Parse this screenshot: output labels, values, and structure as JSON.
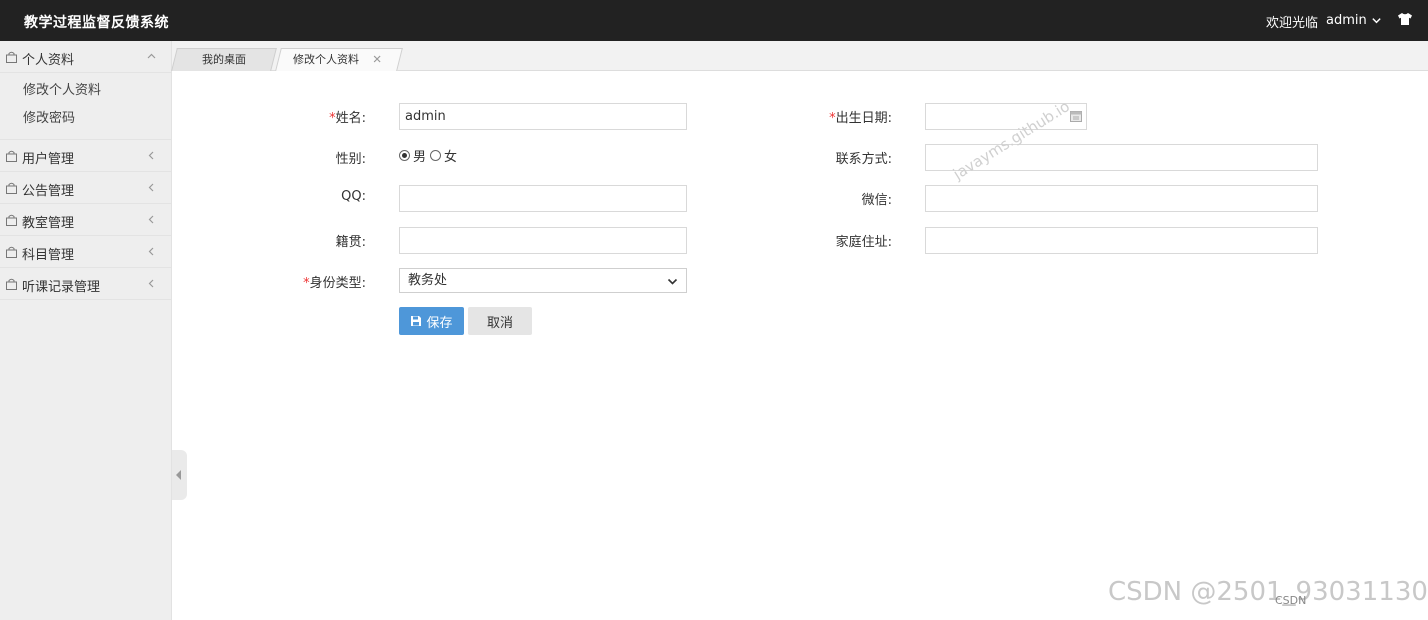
{
  "header": {
    "app_title": "教学过程监督反馈系统",
    "welcome": "欢迎光临",
    "username": "admin"
  },
  "sidebar": {
    "groups": [
      {
        "label": "个人资料",
        "expanded": true,
        "items": [
          "修改个人资料",
          "修改密码"
        ]
      },
      {
        "label": "用户管理",
        "expanded": false
      },
      {
        "label": "公告管理",
        "expanded": false
      },
      {
        "label": "教室管理",
        "expanded": false
      },
      {
        "label": "科目管理",
        "expanded": false
      },
      {
        "label": "听课记录管理",
        "expanded": false
      }
    ]
  },
  "tabs": [
    {
      "label": "我的桌面",
      "active": false
    },
    {
      "label": "修改个人资料",
      "active": true
    }
  ],
  "form": {
    "required_mark": "*",
    "name_label": "姓名:",
    "name_value": "admin",
    "birth_label": "出生日期:",
    "birth_value": "",
    "gender_label": "性别:",
    "gender_options": [
      "男",
      "女"
    ],
    "gender_selected": "男",
    "contact_label": "联系方式:",
    "contact_value": "",
    "qq_label": "QQ:",
    "qq_value": "",
    "wechat_label": "微信:",
    "wechat_value": "",
    "hometown_label": "籍贯:",
    "hometown_value": "",
    "address_label": "家庭住址:",
    "address_value": "",
    "identity_label": "身份类型:",
    "identity_value": "教务处",
    "save_label": "保存",
    "cancel_label": "取消"
  },
  "watermarks": {
    "diagonal": "javayms.github.io",
    "csdn": "CSDN @2501_93031130",
    "small": "CSDN"
  },
  "colors": {
    "header_bg": "#222222",
    "sidebar_bg": "#eeeeee",
    "primary_button": "#4e97d9",
    "required": "#ee3333"
  }
}
